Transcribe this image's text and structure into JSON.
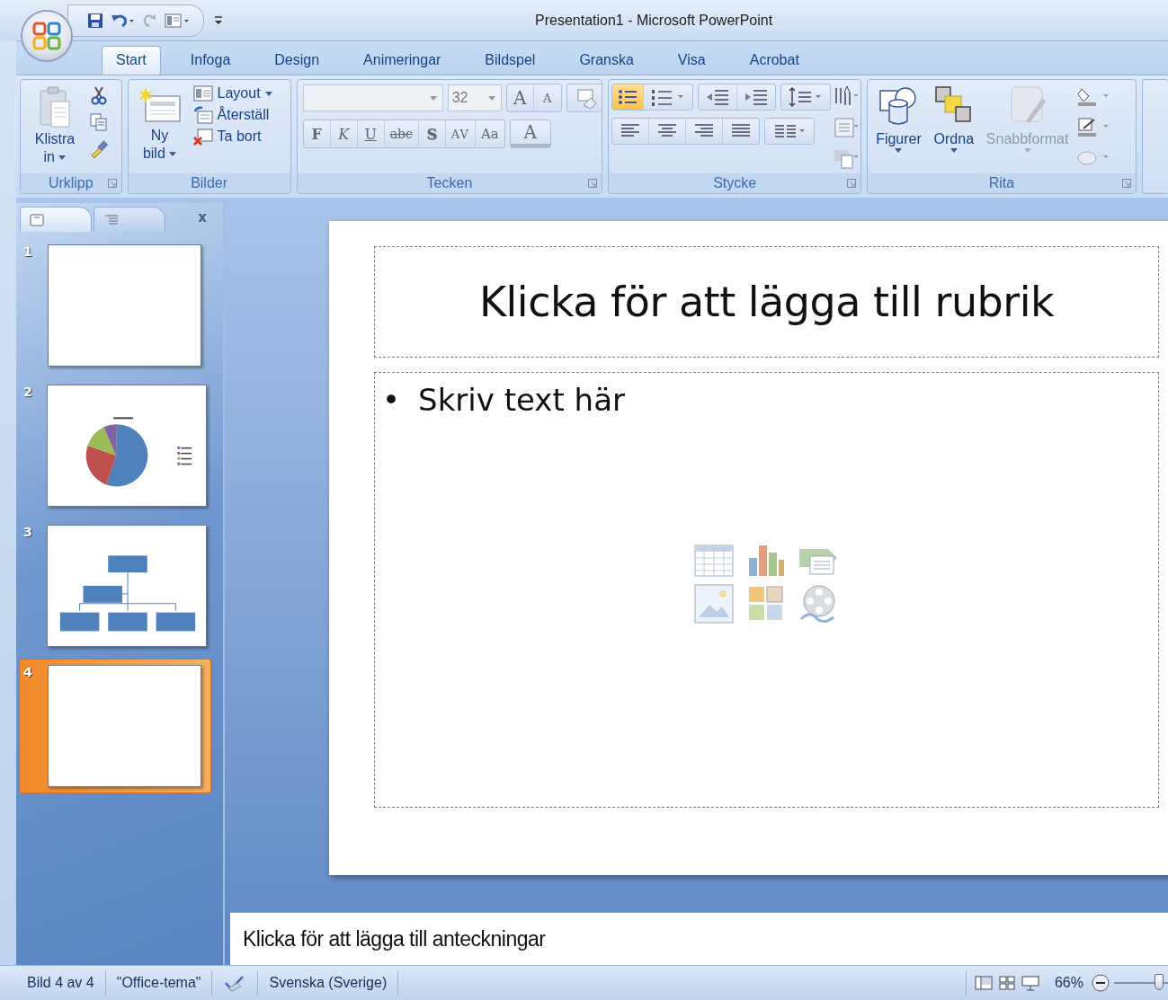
{
  "window": {
    "title": "Presentation1  -  Microsoft PowerPoint"
  },
  "tabs": [
    {
      "label": "Start",
      "selected": true
    },
    {
      "label": "Infoga",
      "selected": false
    },
    {
      "label": "Design",
      "selected": false
    },
    {
      "label": "Animeringar",
      "selected": false
    },
    {
      "label": "Bildspel",
      "selected": false
    },
    {
      "label": "Granska",
      "selected": false
    },
    {
      "label": "Visa",
      "selected": false
    },
    {
      "label": "Acrobat",
      "selected": false
    }
  ],
  "ribbon": {
    "clipboard": {
      "label": "Urklipp",
      "paste": "Klistra in"
    },
    "slides": {
      "label": "Bilder",
      "new_slide": "Ny bild",
      "items": [
        {
          "label": "Layout",
          "kind": "layout"
        },
        {
          "label": "Återställ",
          "kind": "reset"
        },
        {
          "label": "Ta bort",
          "kind": "delete"
        }
      ]
    },
    "font": {
      "label": "Tecken",
      "size": "32",
      "grow": "A",
      "shrink": "A",
      "format_buttons": [
        {
          "label": "F",
          "kind": "bold"
        },
        {
          "label": "K",
          "kind": "italic"
        },
        {
          "label": "U",
          "kind": "underline"
        },
        {
          "label": "abc",
          "kind": "strike"
        },
        {
          "label": "S",
          "kind": "shadow"
        },
        {
          "label": "AV",
          "kind": "spacing"
        },
        {
          "label": "Aa",
          "kind": "case"
        }
      ],
      "color_button": "A"
    },
    "paragraph": {
      "label": "Stycke",
      "bullets_selected": true
    },
    "drawing": {
      "label": "Rita",
      "buttons": [
        {
          "label": "Figurer",
          "kind": "shapes",
          "disabled": false
        },
        {
          "label": "Ordna",
          "kind": "arrange",
          "disabled": false
        },
        {
          "label": "Snabbformat",
          "kind": "styles",
          "disabled": true
        }
      ]
    }
  },
  "panel": {
    "close": "x"
  },
  "slides": [
    {
      "number": "1",
      "kind": "blank",
      "selected": false
    },
    {
      "number": "2",
      "kind": "pie",
      "selected": false
    },
    {
      "number": "3",
      "kind": "org",
      "selected": false
    },
    {
      "number": "4",
      "kind": "blank",
      "selected": true
    }
  ],
  "slide": {
    "title_placeholder": "Klicka för att lägga till rubrik",
    "bullet": "•",
    "body_placeholder": "Skriv text här"
  },
  "notes": {
    "placeholder": "Klicka för att lägga till anteckningar"
  },
  "status_bar": {
    "items": [
      "Bild 4 av 4",
      "\"Office-tema\"",
      "Svenska (Sverige)"
    ],
    "zoom": "66%",
    "zoom_slider": {
      "level": 0.5
    }
  }
}
